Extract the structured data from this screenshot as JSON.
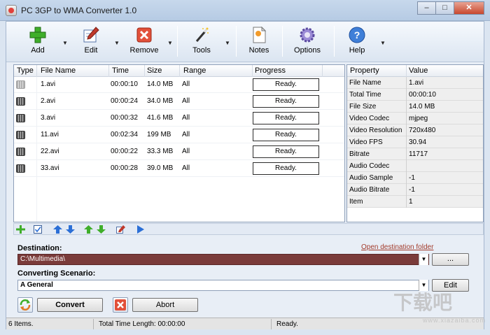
{
  "window": {
    "title": "PC 3GP to WMA Converter 1.0"
  },
  "toolbar": {
    "add": "Add",
    "edit": "Edit",
    "remove": "Remove",
    "tools": "Tools",
    "notes": "Notes",
    "options": "Options",
    "help": "Help"
  },
  "filelist": {
    "headers": [
      "Type",
      "File Name",
      "Time",
      "Size",
      "Range",
      "Progress"
    ],
    "rows": [
      {
        "name": "1.avi",
        "time": "00:00:10",
        "size": "14.0 MB",
        "range": "All",
        "progress": "Ready."
      },
      {
        "name": "2.avi",
        "time": "00:00:24",
        "size": "34.0 MB",
        "range": "All",
        "progress": "Ready."
      },
      {
        "name": "3.avi",
        "time": "00:00:32",
        "size": "41.6 MB",
        "range": "All",
        "progress": "Ready."
      },
      {
        "name": "11.avi",
        "time": "00:02:34",
        "size": "199 MB",
        "range": "All",
        "progress": "Ready."
      },
      {
        "name": "22.avi",
        "time": "00:00:22",
        "size": "33.3 MB",
        "range": "All",
        "progress": "Ready."
      },
      {
        "name": "33.avi",
        "time": "00:00:28",
        "size": "39.0 MB",
        "range": "All",
        "progress": "Ready."
      }
    ]
  },
  "properties": {
    "headers": [
      "Property",
      "Value"
    ],
    "rows": [
      {
        "k": "File Name",
        "v": "1.avi"
      },
      {
        "k": "Total Time",
        "v": "00:00:10"
      },
      {
        "k": "File Size",
        "v": "14.0 MB"
      },
      {
        "k": "Video Codec",
        "v": "mjpeg"
      },
      {
        "k": "Video Resolution",
        "v": "720x480"
      },
      {
        "k": "Video FPS",
        "v": "30.94"
      },
      {
        "k": "Bitrate",
        "v": "11717"
      },
      {
        "k": "Audio Codec",
        "v": ""
      },
      {
        "k": "Audio Sample",
        "v": "-1"
      },
      {
        "k": "Audio Bitrate",
        "v": "-1"
      },
      {
        "k": "Item",
        "v": "1"
      }
    ]
  },
  "destination": {
    "label": "Destination:",
    "value": "C:\\Multimedia\\",
    "open_link": "Open destination folder",
    "browse": "..."
  },
  "scenario": {
    "label": "Converting Scenario:",
    "value": "A General",
    "edit": "Edit"
  },
  "actions": {
    "convert": "Convert",
    "abort": "Abort"
  },
  "status": {
    "items": "6 Items.",
    "total": "Total Time Length: 00:00:00",
    "state": "Ready."
  },
  "watermark": {
    "text": "下载吧",
    "url": "www.xiazaiba.com"
  },
  "colors": {
    "destination_bg": "#7a3b3a",
    "link": "#a23b2b",
    "accent": "#2b6fd6"
  }
}
